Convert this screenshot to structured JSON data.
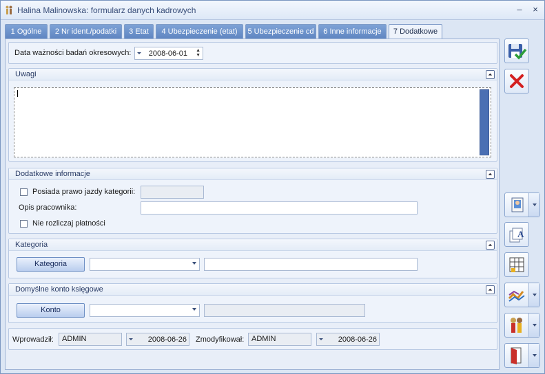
{
  "window": {
    "title": "Halina Malinowska: formularz danych kadrowych",
    "minimize": "–",
    "close": "×"
  },
  "tabs": [
    {
      "label": "1 Ogólne"
    },
    {
      "label": "2 Nr ident./podatki"
    },
    {
      "label": "3 Etat"
    },
    {
      "label": "4 Ubezpieczenie (etat)"
    },
    {
      "label": "5 Ubezpieczenie cd"
    },
    {
      "label": "6 Inne informacje"
    },
    {
      "label": "7 Dodatkowe",
      "active": true
    }
  ],
  "badania": {
    "label": "Data ważności badań okresowych:",
    "date": "2008-06-01"
  },
  "uwagi": {
    "title": "Uwagi",
    "text": ""
  },
  "dodatkowe": {
    "title": "Dodatkowe informacje",
    "prawo_jazdy_label": "Posiada prawo jazdy kategorii:",
    "prawo_jazdy_value": "",
    "opis_label": "Opis pracownika:",
    "opis_value": "",
    "nie_rozliczaj_label": "Nie rozliczaj płatności"
  },
  "kategoria": {
    "title": "Kategoria",
    "button": "Kategoria",
    "combo_value": "",
    "text_value": ""
  },
  "konto": {
    "title": "Domyślne konto księgowe",
    "button": "Konto",
    "combo_value": "",
    "text_value": ""
  },
  "footer": {
    "wprowadzil_label": "Wprowadził:",
    "wprowadzil_user": "ADMIN",
    "wprowadzil_date": "2008-06-26",
    "zmodyfikowal_label": "Zmodyfikował:",
    "zmodyfikowal_user": "ADMIN",
    "zmodyfikowal_date": "2008-06-26"
  },
  "colors": {
    "accent": "#5d84c0",
    "save_check": "#2e9e3a",
    "cancel_x": "#d42020"
  },
  "side_buttons": [
    "save-icon",
    "cancel-icon",
    "employee-card-icon",
    "documents-icon",
    "table-icon",
    "chart-icon",
    "people-icon",
    "door-icon"
  ]
}
